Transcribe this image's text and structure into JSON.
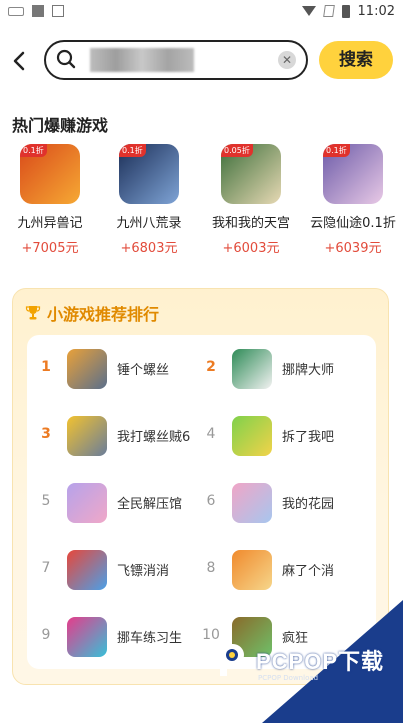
{
  "status_bar": {
    "time": "11:02"
  },
  "search": {
    "value": "",
    "placeholder": "",
    "button_label": "搜索"
  },
  "hot_section": {
    "title": "热门爆赚游戏",
    "games": [
      {
        "name": "九州异兽记",
        "earn": "+7005元",
        "badge": "0.1折",
        "color1": "#d94a1a",
        "color2": "#f6a934"
      },
      {
        "name": "九州八荒录",
        "earn": "+6803元",
        "badge": "0.1折",
        "color1": "#1b2e57",
        "color2": "#7fa4d6"
      },
      {
        "name": "我和我的天宫",
        "earn": "+6003元",
        "badge": "0.05折",
        "color1": "#3c6e3a",
        "color2": "#e7d9b4"
      },
      {
        "name": "云隐仙途0.1折",
        "earn": "+6039元",
        "badge": "0.1折",
        "color1": "#6c5ba8",
        "color2": "#e8c9e6"
      }
    ]
  },
  "rank_section": {
    "title": "小游戏推荐排行",
    "items": [
      {
        "rank": "1",
        "name": "锤个螺丝",
        "color1": "#e9a13a",
        "color2": "#5a6f8b"
      },
      {
        "rank": "2",
        "name": "挪牌大师",
        "color1": "#2e8b57",
        "color2": "#f2f2f2"
      },
      {
        "rank": "3",
        "name": "我打螺丝贼6",
        "color1": "#f2c230",
        "color2": "#6a7d9a"
      },
      {
        "rank": "4",
        "name": "拆了我吧",
        "color1": "#7fd14b",
        "color2": "#f2d34a"
      },
      {
        "rank": "5",
        "name": "全民解压馆",
        "color1": "#b6a2ea",
        "color2": "#f0a8c8"
      },
      {
        "rank": "6",
        "name": "我的花园",
        "color1": "#f0a5c6",
        "color2": "#a7c6ee"
      },
      {
        "rank": "7",
        "name": "飞镖消消",
        "color1": "#e8473a",
        "color2": "#4aa0e8"
      },
      {
        "rank": "8",
        "name": "麻了个消",
        "color1": "#f08a2d",
        "color2": "#f6d68b"
      },
      {
        "rank": "9",
        "name": "挪车练习生",
        "color1": "#e63c8a",
        "color2": "#37c0d8"
      },
      {
        "rank": "10",
        "name": "疯狂",
        "color1": "#8a6a2a",
        "color2": "#6fc16a"
      }
    ]
  },
  "watermark": {
    "text": "PCPOP下载",
    "sub": "PCPOP Download"
  }
}
